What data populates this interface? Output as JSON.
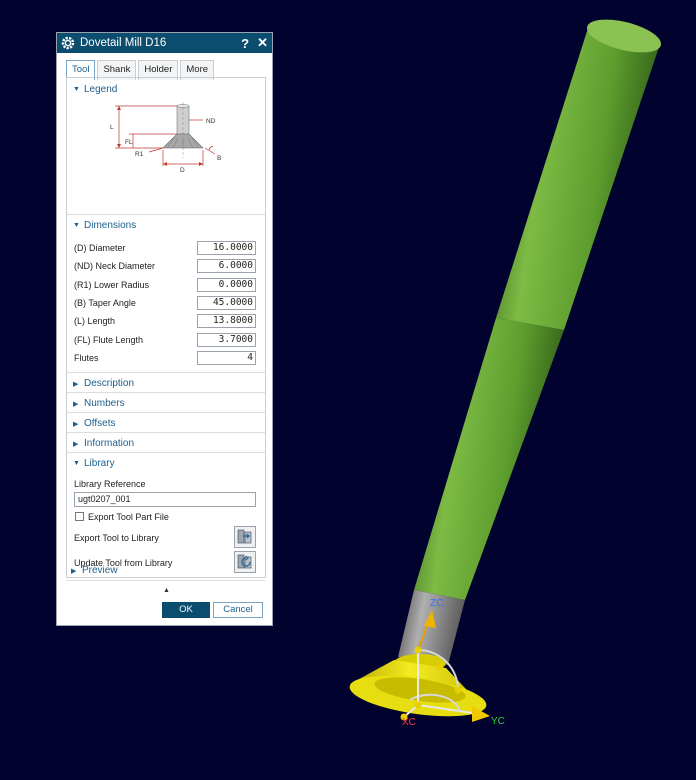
{
  "dialog": {
    "title": "Dovetail Mill D16",
    "help_glyph": "?",
    "close_glyph": "✕",
    "tabs": [
      {
        "label": "Tool",
        "active": true
      },
      {
        "label": "Shank",
        "active": false
      },
      {
        "label": "Holder",
        "active": false
      },
      {
        "label": "More",
        "active": false
      }
    ],
    "legend": {
      "title": "Legend",
      "labels": {
        "nd": "ND",
        "l": "L",
        "fl": "FL",
        "r1": "R1",
        "d": "D",
        "b": "B"
      }
    },
    "dimensions": {
      "title": "Dimensions",
      "fields": [
        {
          "label": "(D) Diameter",
          "value": "16.0000"
        },
        {
          "label": "(ND) Neck Diameter",
          "value": "6.0000"
        },
        {
          "label": "(R1) Lower Radius",
          "value": "0.0000"
        },
        {
          "label": "(B) Taper Angle",
          "value": "45.0000"
        },
        {
          "label": "(L) Length",
          "value": "13.8000"
        },
        {
          "label": "(FL) Flute Length",
          "value": "3.7000"
        },
        {
          "label": "Flutes",
          "value": "4"
        }
      ]
    },
    "collapsed_sections": [
      "Description",
      "Numbers",
      "Offsets",
      "Information"
    ],
    "library": {
      "title": "Library",
      "reference_label": "Library Reference",
      "reference_value": "ugt0207_001",
      "export_part_label": "Export Tool Part File",
      "export_part_checked": false,
      "export_label": "Export Tool to Library",
      "update_label": "Update Tool from Library"
    },
    "preview": {
      "title": "Preview"
    },
    "ok_label": "OK",
    "cancel_label": "Cancel"
  },
  "viewport": {
    "background": "#02022e",
    "tool_color": "#5e9e2e",
    "head_color": "#e8e000",
    "axes": {
      "zc": "ZC",
      "xc": "XC",
      "yc": "YC"
    }
  }
}
